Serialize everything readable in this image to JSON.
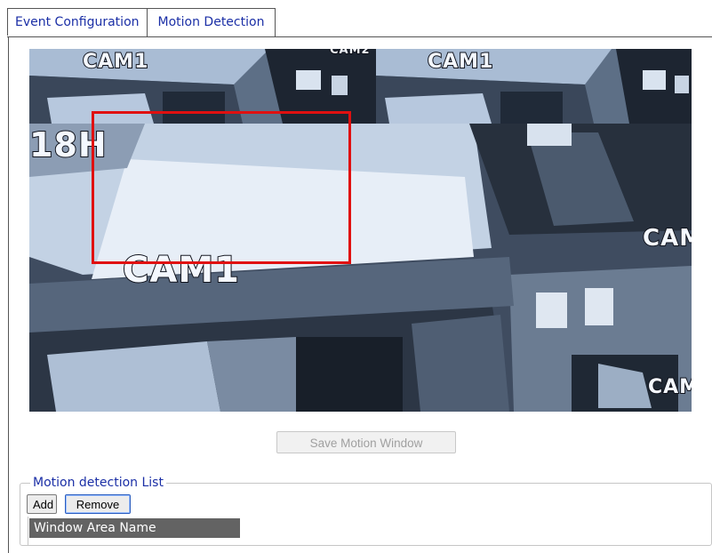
{
  "tabs": [
    {
      "label": "Event Configuration"
    },
    {
      "label": "Motion Detection"
    }
  ],
  "video": {
    "labels": {
      "top_left": "CAM1",
      "top_left_small": "CAM2",
      "top_right": "CAM1",
      "main_cam": "CAM1",
      "main_ch": "18H",
      "right_mid": "CAM",
      "bottom_right": "CAM"
    },
    "motion_window_color": "#e01010"
  },
  "save_button": {
    "label": "Save Motion Window",
    "enabled": false
  },
  "motion_list": {
    "legend": "Motion detection List",
    "add_label": "Add",
    "remove_label": "Remove",
    "column_header": "Window Area Name"
  }
}
